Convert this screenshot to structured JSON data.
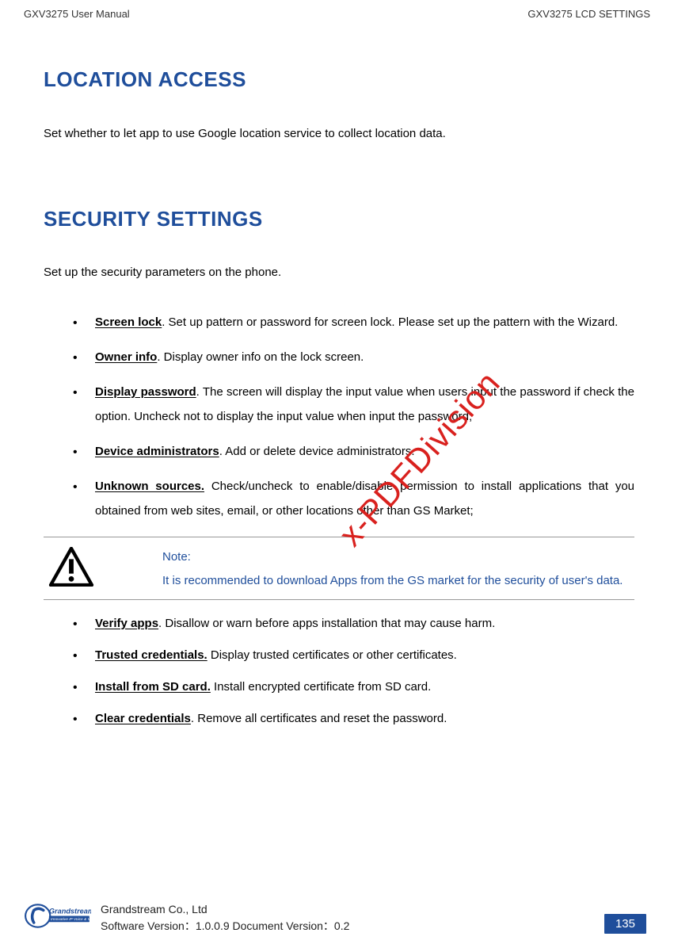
{
  "header": {
    "left": "GXV3275 User Manual",
    "right": "GXV3275 LCD SETTINGS"
  },
  "section1": {
    "heading": "LOCATION ACCESS",
    "intro": "Set whether to let app to use Google location service to collect location data."
  },
  "section2": {
    "heading": "SECURITY SETTINGS",
    "intro": "Set up the security parameters on the phone.",
    "bullets": [
      {
        "bold": "Screen lock",
        "text": ". Set up pattern or password for screen lock. Please set up the pattern with the Wizard."
      },
      {
        "bold": "Owner info",
        "text": ". Display owner info on the lock screen."
      },
      {
        "bold": "Display password",
        "text": ". The screen will display the input value when users input the password if check the option. Uncheck not to display the input value when input the password;"
      },
      {
        "bold": "Device administrators",
        "text": ". Add or delete device administrators."
      },
      {
        "bold": "Unknown sources.",
        "text": " Check/uncheck to enable/disable permission to install applications that you obtained from web sites, email, or other locations other than GS Market;"
      }
    ],
    "bullets2": [
      {
        "bold": "Verify apps",
        "text": ". Disallow or warn before apps installation that may cause harm."
      },
      {
        "bold": "Trusted credentials.",
        "text": " Display trusted certificates or other certificates."
      },
      {
        "bold": "Install from SD card.",
        "text": " Install encrypted certificate from SD card."
      },
      {
        "bold": "Clear credentials",
        "text": ". Remove all certificates and reset the password."
      }
    ]
  },
  "note": {
    "label": "Note:",
    "body": "It is recommended to download Apps from the GS market for the security of user's data."
  },
  "watermark": "x-PDFDivision",
  "footer": {
    "company": "Grandstream Co., Ltd",
    "version": "Software Version：1.0.0.9 Document Version：0.2",
    "page": "135",
    "logo_top": "Grandstream",
    "logo_sub": "Innovative IP Voice & Video"
  }
}
